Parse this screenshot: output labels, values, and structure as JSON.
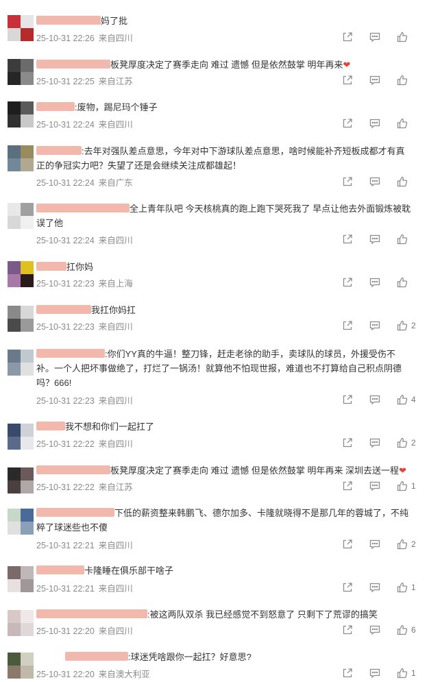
{
  "colors": {
    "text": "#333333",
    "meta": "#8a8a8a",
    "icon": "#8c8c8c",
    "username_blur": "#f2b8ab",
    "heart": "#e8403b"
  },
  "icons": {
    "forward": "forward-icon",
    "comment": "comment-icon",
    "like": "like-icon"
  },
  "comments": [
    {
      "username_blur": true,
      "text": "妈了批",
      "date": "25-10-31 22:26",
      "location": "来自四川",
      "likes": ""
    },
    {
      "username_blur": true,
      "text": "板凳厚度决定了赛季走向 难过 遗憾 但是依然鼓掌 明年再来",
      "heart": "❤",
      "date": "25-10-31 22:25",
      "location": "来自江苏",
      "likes": ""
    },
    {
      "username_blur": true,
      "text": ":废物，踢尼玛个锤子",
      "date": "25-10-31 22:24",
      "location": "来自四川",
      "likes": ""
    },
    {
      "username_blur": true,
      "text": ":去年对强队差点意思，今年对中下游球队差点意思，啥时候能补齐短板成都才有真正的争冠实力吧？失望了还是会继续关注成都雄起！",
      "date": "25-10-31 22:24",
      "location": "来自广东",
      "likes": ""
    },
    {
      "username_blur": true,
      "text": "全上青年队吧 今天核桃真的跑上跑下哭死我了 早点让他去外面锻炼被耽误了他",
      "date": "25-10-31 22:24",
      "location": "来自四川",
      "likes": ""
    },
    {
      "username_blur": true,
      "text": "扛你妈",
      "date": "25-10-31 22:23",
      "location": "来自上海",
      "likes": ""
    },
    {
      "username_blur": true,
      "text": "我扛你妈扛",
      "date": "25-10-31 22:23",
      "location": "来自四川",
      "likes": "2"
    },
    {
      "username_blur": true,
      "text": ":你们YY真的牛逼！整刀锋，赶走老徐的助手，卖球队的球员，外援受伤不补。一个人把坏事做绝了，打烂了一锅汤！就算他不怕现世报，难道也不打算给自己积点阴德吗？666!",
      "date": "25-10-31 22:23",
      "location": "来自四川",
      "likes": "4"
    },
    {
      "username_blur": true,
      "text": "我不想和你们一起扛了",
      "date": "25-10-31 22:22",
      "location": "来自四川",
      "likes": "2"
    },
    {
      "username_blur": true,
      "text": "板凳厚度决定了赛季走向 难过 遗憾 但是依然鼓掌 明年再来 深圳去送一程",
      "heart": "❤",
      "date": "25-10-31 22:22",
      "location": "来自江苏",
      "likes": "1"
    },
    {
      "username_blur": true,
      "text": "下低的薪资整来韩鹏飞、德尔加多、卡隆就晓得不是那几年的蓉城了，不纯粹了球迷些也不傻",
      "date": "25-10-31 22:21",
      "location": "来自四川",
      "likes": "2"
    },
    {
      "username_blur": true,
      "text": "卡隆睡在俱乐部干啥子",
      "date": "25-10-31 22:21",
      "location": "来自四川",
      "likes": "1"
    },
    {
      "username_blur": true,
      "text": ":被这两队双杀 我已经感觉不到怒意了 只剩下了荒谬的搞笑",
      "date": "25-10-31 22:20",
      "location": "来自四川",
      "likes": "6"
    },
    {
      "username_blur": true,
      "text": ":球迷凭啥跟你一起扛？好意思?",
      "date": "25-10-31 22:20",
      "location": "来自澳大利亚",
      "likes": "1"
    }
  ]
}
